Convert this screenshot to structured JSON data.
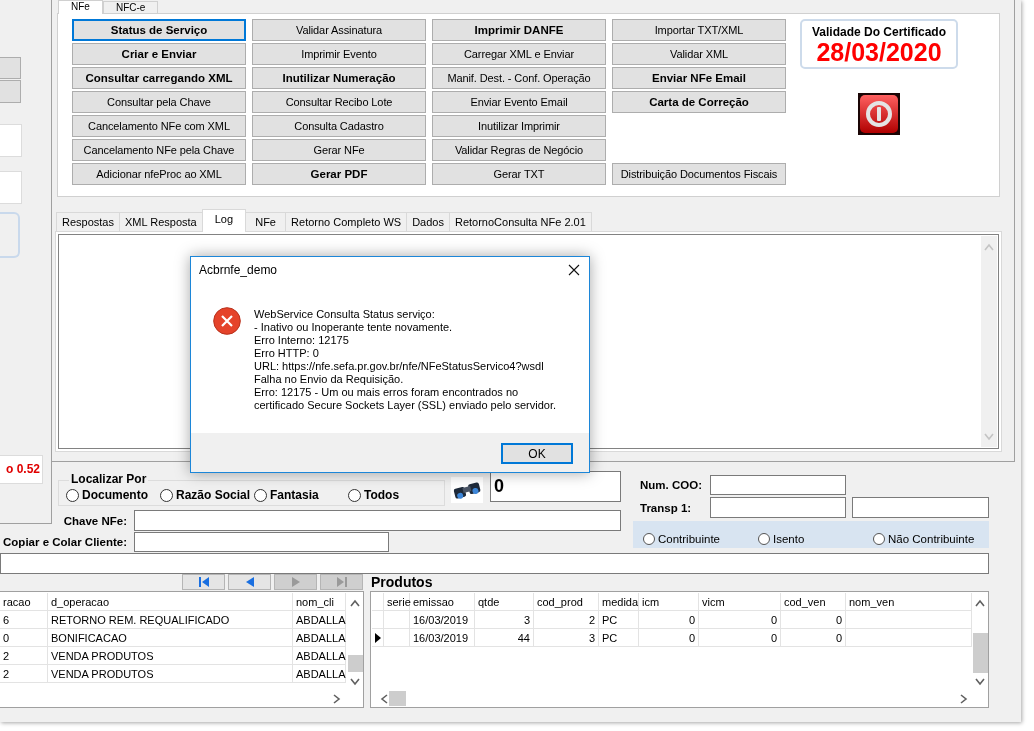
{
  "form_tabs": [
    {
      "label": "NFe",
      "selected": true
    },
    {
      "label": "NFC-e",
      "selected": false
    }
  ],
  "service_buttons": [
    [
      {
        "kind": "button",
        "label": "Status de Serviço",
        "bold": true,
        "focused": true
      },
      {
        "kind": "button",
        "label": "Validar Assinatura",
        "bold": false,
        "focused": false
      },
      {
        "kind": "button",
        "label": "Imprimir DANFE",
        "bold": true,
        "focused": false
      },
      {
        "kind": "button",
        "label": "Importar TXT/XML",
        "bold": false,
        "focused": false
      }
    ],
    [
      {
        "kind": "button",
        "label": "Criar e Enviar",
        "bold": true,
        "focused": false
      },
      {
        "kind": "button",
        "label": "Imprimir Evento",
        "bold": false,
        "focused": false
      },
      {
        "kind": "button",
        "label": "Carregar XML e Enviar",
        "bold": false,
        "focused": false
      },
      {
        "kind": "button",
        "label": "Validar XML",
        "bold": false,
        "focused": false
      }
    ],
    [
      {
        "kind": "button",
        "label": "Consultar carregando XML",
        "bold": true,
        "focused": false
      },
      {
        "kind": "button",
        "label": "Inutilizar Numeração",
        "bold": true,
        "focused": false
      },
      {
        "kind": "button",
        "label": "Manif. Dest. - Conf. Operação",
        "bold": false,
        "focused": false
      },
      {
        "kind": "button",
        "label": "Enviar NFe Email",
        "bold": true,
        "focused": false
      }
    ],
    [
      {
        "kind": "button",
        "label": "Consultar pela Chave",
        "bold": false,
        "focused": false
      },
      {
        "kind": "button",
        "label": "Consultar Recibo Lote",
        "bold": false,
        "focused": false
      },
      {
        "kind": "button",
        "label": "Enviar Evento Email",
        "bold": false,
        "focused": false
      },
      {
        "kind": "button",
        "label": "Carta de Correção",
        "bold": true,
        "focused": false
      }
    ],
    [
      {
        "kind": "button",
        "label": "Cancelamento NFe com XML",
        "bold": false,
        "focused": false
      },
      {
        "kind": "button",
        "label": "Consulta Cadastro",
        "bold": false,
        "focused": false
      },
      {
        "kind": "button",
        "label": "Inutilizar Imprimir",
        "bold": false,
        "focused": false
      },
      {
        "kind": "empty"
      }
    ],
    [
      {
        "kind": "button",
        "label": "Cancelamento NFe pela Chave",
        "bold": false,
        "focused": false
      },
      {
        "kind": "button",
        "label": "Gerar NFe",
        "bold": false,
        "focused": false
      },
      {
        "kind": "button",
        "label": "Validar Regras de Negócio",
        "bold": false,
        "focused": false
      },
      {
        "kind": "empty"
      }
    ],
    [
      {
        "kind": "button",
        "label": "Adicionar nfeProc ao XML",
        "bold": false,
        "focused": false
      },
      {
        "kind": "button",
        "label": "Gerar PDF",
        "bold": true,
        "focused": false
      },
      {
        "kind": "button",
        "label": "Gerar TXT",
        "bold": false,
        "focused": false
      },
      {
        "kind": "button",
        "label": "Distribuição Documentos Fiscais",
        "bold": false,
        "focused": false
      }
    ]
  ],
  "certificate": {
    "title": "Validade Do Certificado",
    "date": "28/03/2020"
  },
  "result_tabs": [
    {
      "label": "Respostas",
      "selected": false
    },
    {
      "label": "XML Resposta",
      "selected": false
    },
    {
      "label": "Log",
      "selected": true
    },
    {
      "label": "NFe",
      "selected": false
    },
    {
      "label": "Retorno Completo WS",
      "selected": false
    },
    {
      "label": "Dados",
      "selected": false
    },
    {
      "label": "RetornoConsulta NFe 2.01",
      "selected": false
    }
  ],
  "left_panel": {
    "label": "o 0.52"
  },
  "search": {
    "title": "Localizar Por",
    "options": [
      {
        "label": "Documento",
        "selected": false
      },
      {
        "label": "Razão Social",
        "selected": false
      },
      {
        "label": "Fantasia",
        "selected": false
      },
      {
        "label": "Todos",
        "selected": false
      }
    ],
    "count": "0",
    "chave_nfe_label": "Chave NFe:",
    "copiar_colar_label": "Copiar e Colar Cliente:"
  },
  "fiscal": {
    "num_coo_label": "Num. COO:",
    "transp_label": "Transp 1:",
    "options": [
      {
        "label": "Contribuinte",
        "selected": false
      },
      {
        "label": "Isento",
        "selected": false
      },
      {
        "label": "Não Contribuinte",
        "selected": false
      }
    ]
  },
  "navigator": [
    {
      "kind": "first",
      "disabled": false
    },
    {
      "kind": "prior",
      "disabled": false
    },
    {
      "kind": "next",
      "disabled": true
    },
    {
      "kind": "last",
      "disabled": true
    }
  ],
  "operations_grid": {
    "columns": [
      {
        "label": "racao",
        "kind": "text"
      },
      {
        "label": "d_operacao",
        "kind": "text"
      },
      {
        "label": "nom_cli",
        "kind": "text"
      }
    ],
    "rows": [
      {
        "cells": [
          "6",
          "RETORNO REM. REQUALIFICADO",
          "ABDALLA"
        ]
      },
      {
        "cells": [
          "0",
          "BONIFICACAO",
          "ABDALLA"
        ]
      },
      {
        "cells": [
          "2",
          "VENDA PRODUTOS",
          "ABDALLA"
        ]
      },
      {
        "cells": [
          "2",
          "VENDA PRODUTOS",
          "ABDALLA"
        ]
      }
    ]
  },
  "products_grid": {
    "title": "Produtos",
    "columns": [
      {
        "label": "serie",
        "kind": "text"
      },
      {
        "label": "emissao",
        "kind": "text"
      },
      {
        "label": "qtde",
        "kind": "number"
      },
      {
        "label": "cod_prod",
        "kind": "number"
      },
      {
        "label": "medida",
        "kind": "text"
      },
      {
        "label": "icm",
        "kind": "number"
      },
      {
        "label": "vicm",
        "kind": "number"
      },
      {
        "label": "cod_ven",
        "kind": "number"
      },
      {
        "label": "nom_ven",
        "kind": "text"
      }
    ],
    "rows": [
      {
        "selected": false,
        "cells": [
          null,
          "16/03/2019",
          "3",
          "2",
          "PC",
          "0",
          "0",
          "0",
          null
        ]
      },
      {
        "selected": true,
        "cells": [
          null,
          "16/03/2019",
          "44",
          "3",
          "PC",
          "0",
          "0",
          "0",
          null
        ]
      }
    ]
  },
  "dialog": {
    "title": "Acbrnfe_demo",
    "message_lines": [
      "WebService Consulta Status serviço:",
      "- Inativo ou Inoperante tente novamente.",
      "Erro Interno: 12175",
      "Erro HTTP: 0",
      "URL: https://nfe.sefa.pr.gov.br/nfe/NFeStatusServico4?wsdl",
      "Falha no Envio da Requisição.",
      "Erro: 12175 - Um ou mais erros foram encontrados no",
      "certificado Secure Sockets Layer (SSL) enviado pelo servidor."
    ],
    "buttons": [
      {
        "label": "OK",
        "focused": true
      }
    ]
  }
}
